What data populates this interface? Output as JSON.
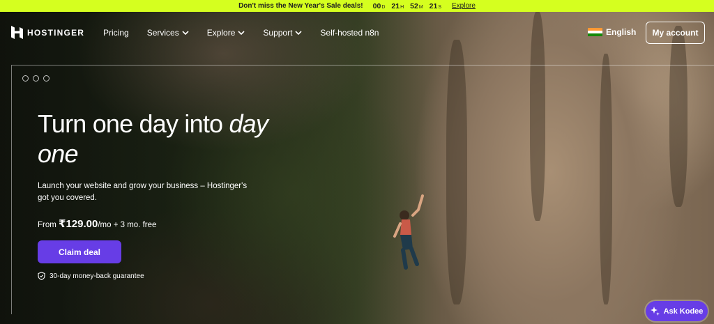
{
  "promo": {
    "message": "Don't miss the New Year's Sale deals!",
    "countdown": [
      {
        "value": "00",
        "unit": "D"
      },
      {
        "value": "21",
        "unit": "H"
      },
      {
        "value": "52",
        "unit": "M"
      },
      {
        "value": "21",
        "unit": "S"
      }
    ],
    "link": "Explore",
    "background": "#d5ff1f"
  },
  "header": {
    "logo_text": "HOSTINGER",
    "nav": [
      {
        "label": "Pricing",
        "has_dropdown": false
      },
      {
        "label": "Services",
        "has_dropdown": true
      },
      {
        "label": "Explore",
        "has_dropdown": true
      },
      {
        "label": "Support",
        "has_dropdown": true
      },
      {
        "label": "Self-hosted n8n",
        "has_dropdown": false
      }
    ],
    "language": "English",
    "account_button": "My account"
  },
  "hero": {
    "headline_plain": "Turn one day into ",
    "headline_italic_1": "day",
    "headline_italic_2": "one",
    "subtitle": "Launch your website and grow your business – Hostinger's got you covered.",
    "price_prefix": "From ",
    "price": "₹129.00",
    "price_suffix": "/mo + 3 mo. free",
    "cta": "Claim deal",
    "guarantee": "30-day money-back guarantee"
  },
  "chat": {
    "label": "Ask Kodee"
  },
  "colors": {
    "accent": "#673de6",
    "promo": "#d5ff1f",
    "text_light": "#ffffff"
  }
}
